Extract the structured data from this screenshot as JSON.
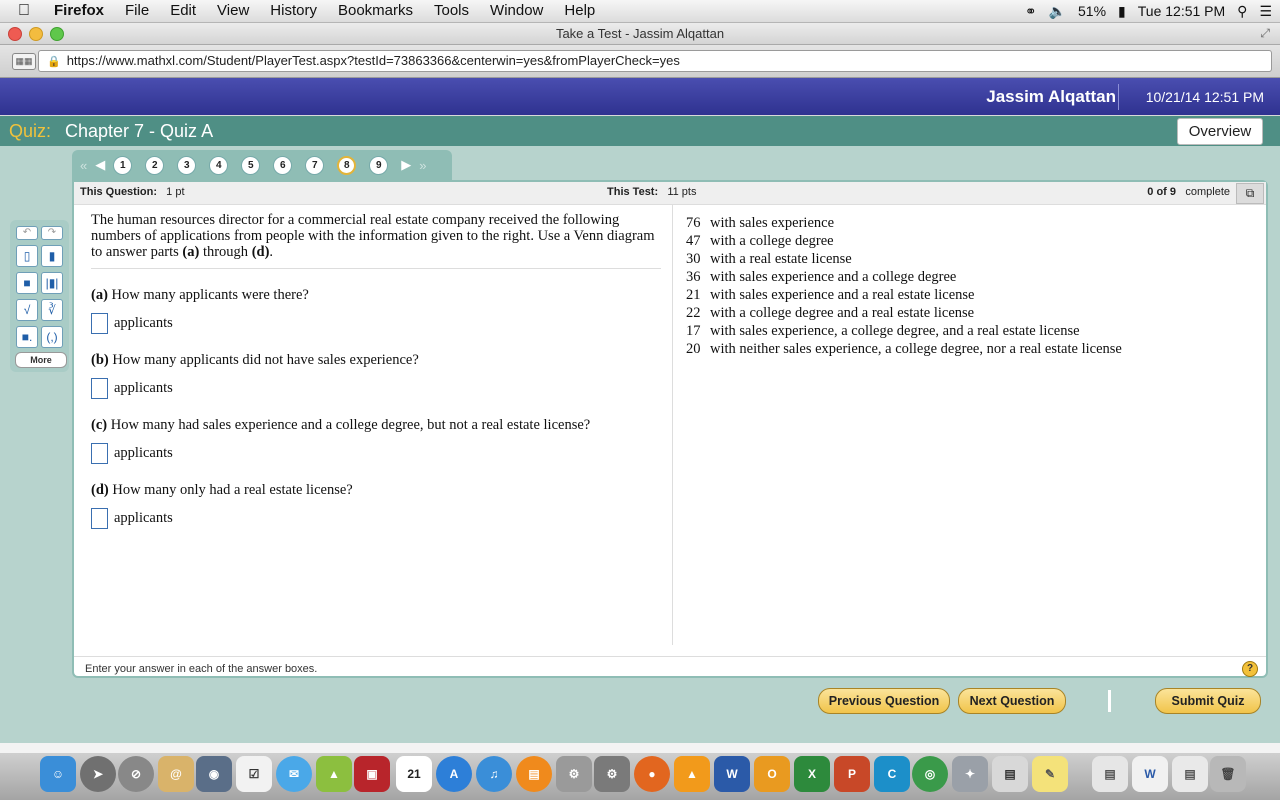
{
  "menubar": {
    "apple": "",
    "app": "Firefox",
    "items": [
      "File",
      "Edit",
      "View",
      "History",
      "Bookmarks",
      "Tools",
      "Window",
      "Help"
    ],
    "battery": "51%",
    "clock": "Tue 12:51 PM"
  },
  "window": {
    "title": "Take a Test - Jassim Alqattan",
    "url": "https://www.mathxl.com/Student/PlayerTest.aspx?testId=73863366&centerwin=yes&fromPlayerCheck=yes"
  },
  "header": {
    "user": "Jassim Alqattan",
    "datetime": "10/21/14 12:51 PM",
    "quiz_label": "Quiz:",
    "quiz_title": "Chapter 7 - Quiz A",
    "overview": "Overview"
  },
  "nav": {
    "questions": [
      "1",
      "2",
      "3",
      "4",
      "5",
      "6",
      "7",
      "8",
      "9"
    ],
    "current": "8"
  },
  "info": {
    "this_question_label": "This Question:",
    "this_question_value": "1 pt",
    "this_test_label": "This Test:",
    "this_test_value": "11 pts",
    "progress": "0 of 9",
    "complete": "complete"
  },
  "question": {
    "intro": "The human resources director for a commercial real estate company received the following numbers of applications from people with the information given to the right.  Use a Venn diagram to answer parts ",
    "intro_a": "(a)",
    "intro_mid": " through ",
    "intro_d": "(d)",
    "intro_end": ".",
    "parts": [
      {
        "tag": "(a)",
        "text": " How many applicants were there?",
        "unit": "applicants"
      },
      {
        "tag": "(b)",
        "text": " How many applicants did not have sales experience?",
        "unit": "applicants"
      },
      {
        "tag": "(c)",
        "text": " How many had sales experience and a college degree, but not a real estate license?",
        "unit": "applicants"
      },
      {
        "tag": "(d)",
        "text": " How many only had a real estate license?",
        "unit": "applicants"
      }
    ],
    "data": [
      {
        "n": "76",
        "text": "with sales experience"
      },
      {
        "n": "47",
        "text": "with a college degree"
      },
      {
        "n": "30",
        "text": "with a real estate license"
      },
      {
        "n": "36",
        "text": "with sales experience and a college degree"
      },
      {
        "n": "21",
        "text": "with sales experience and a real estate license"
      },
      {
        "n": "22",
        "text": "with a college degree and a real estate license"
      },
      {
        "n": "17",
        "text": "with sales experience, a college degree, and a real estate license"
      },
      {
        "n": "20",
        "text": "with neither sales experience, a college degree, nor a real estate license"
      }
    ]
  },
  "footer": {
    "hint": "Enter your answer in each of the answer boxes.",
    "help": "?"
  },
  "buttons": {
    "previous": "Previous Question",
    "next": "Next Question",
    "submit": "Submit Quiz"
  },
  "toolbox": {
    "more": "More"
  }
}
